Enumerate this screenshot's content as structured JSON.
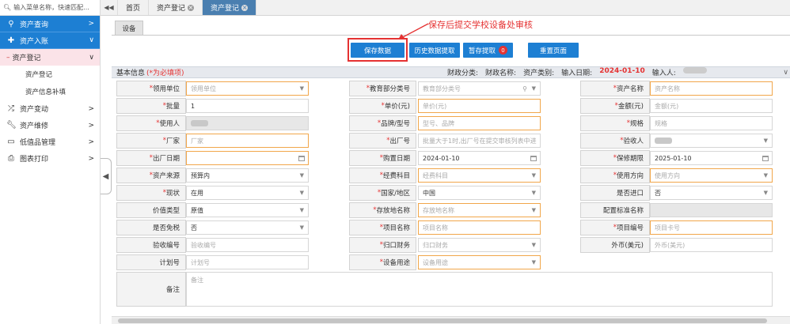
{
  "sidebar": {
    "search_placeholder": "输入菜单名称，快速匹配...",
    "items": [
      {
        "label": "资产查询",
        "icon": "search-icon",
        "chev": ">"
      },
      {
        "label": "资产入账",
        "icon": "plus-icon",
        "chev": "∨"
      },
      {
        "label": "资产登记",
        "chev": "∨"
      },
      {
        "label": "资产登记"
      },
      {
        "label": "资产信息补填"
      },
      {
        "label": "资产变动",
        "icon": "shuffle-icon",
        "chev": ">"
      },
      {
        "label": "资产维修",
        "icon": "wrench-icon",
        "chev": ">"
      },
      {
        "label": "低值品管理",
        "icon": "monitor-icon",
        "chev": ">"
      },
      {
        "label": "图表打印",
        "icon": "printer-icon",
        "chev": ">"
      }
    ]
  },
  "topbar": {
    "nav_left": "◀◀",
    "tabs": [
      {
        "label": "首页"
      },
      {
        "label": "资产登记",
        "close": "×"
      },
      {
        "label": "资产登记",
        "close": "×"
      }
    ]
  },
  "subtab": "设备",
  "annotation": "保存后提交学校设备处审核",
  "buttons": {
    "save": "保存数据",
    "history": "历史数据提取",
    "draft": "暂存提取",
    "draft_count": "0",
    "reset": "重置页面"
  },
  "info": {
    "title": "基本信息",
    "required_note": "(*为必填项)",
    "finance_class": "财政分类:",
    "finance_name": "财政名称:",
    "asset_type": "资产类别:",
    "input_date_label": "输入日期:",
    "input_date": "2024-01-10",
    "input_person_label": "输入人:"
  },
  "form": {
    "rows": [
      [
        {
          "label": "领用单位",
          "req": true,
          "placeholder": "领用单位",
          "style": "orange",
          "icon": "caret"
        },
        {
          "label": "教育部分类号",
          "req": true,
          "placeholder": "教育部分类号",
          "style": "plain",
          "icon": "search-caret"
        },
        {
          "label": "资产名称",
          "req": true,
          "placeholder": "资产名称",
          "style": "orange"
        }
      ],
      [
        {
          "label": "批量",
          "req": true,
          "value": "1",
          "style": "plain"
        },
        {
          "label": "单价(元)",
          "req": true,
          "placeholder": "单价(元)",
          "style": "orange"
        },
        {
          "label": "金额(元)",
          "req": true,
          "placeholder": "金额(元)",
          "style": "plain"
        }
      ],
      [
        {
          "label": "使用人",
          "req": true,
          "blur": true,
          "style": "gray"
        },
        {
          "label": "品牌/型号",
          "req": true,
          "placeholder": "型号、品牌",
          "style": "orange"
        },
        {
          "label": "规格",
          "req": true,
          "placeholder": "规格",
          "style": "plain"
        }
      ],
      [
        {
          "label": "厂家",
          "req": true,
          "placeholder": "厂家",
          "style": "orange"
        },
        {
          "label": "出厂号",
          "req": true,
          "placeholder": "批量大于1时,出厂号在提交审核列表中进",
          "style": "plain"
        },
        {
          "label": "验收人",
          "req": true,
          "blur": true,
          "style": "plain",
          "icon": "caret"
        }
      ],
      [
        {
          "label": "出厂日期",
          "req": true,
          "value": "",
          "style": "orange",
          "icon": "cal"
        },
        {
          "label": "购置日期",
          "req": true,
          "value": "2024-01-10",
          "style": "plain",
          "icon": "cal"
        },
        {
          "label": "保修期限",
          "req": true,
          "value": "2025-01-10",
          "style": "plain",
          "icon": "cal"
        }
      ],
      [
        {
          "label": "资产来源",
          "req": true,
          "value": "预算内",
          "style": "plain",
          "icon": "caret"
        },
        {
          "label": "经费科目",
          "req": true,
          "placeholder": "经费科目",
          "style": "orange",
          "icon": "caret"
        },
        {
          "label": "使用方向",
          "req": true,
          "placeholder": "使用方向",
          "style": "orange",
          "icon": "caret"
        }
      ],
      [
        {
          "label": "现状",
          "req": true,
          "value": "在用",
          "style": "plain",
          "icon": "caret"
        },
        {
          "label": "国家/地区",
          "req": true,
          "value": "中国",
          "style": "plain",
          "icon": "caret"
        },
        {
          "label": "是否进口",
          "req": false,
          "value": "否",
          "style": "plain",
          "icon": "caret"
        }
      ],
      [
        {
          "label": "价值类型",
          "req": false,
          "value": "原值",
          "style": "plain",
          "icon": "caret"
        },
        {
          "label": "存放地名称",
          "req": true,
          "placeholder": "存放地名称",
          "style": "orange",
          "icon": "caret"
        },
        {
          "label": "配置标准名称",
          "req": false,
          "value": "",
          "style": "gray"
        }
      ],
      [
        {
          "label": "是否免税",
          "req": false,
          "value": "否",
          "style": "plain",
          "icon": "caret"
        },
        {
          "label": "项目名称",
          "req": true,
          "placeholder": "项目名称",
          "style": "orange"
        },
        {
          "label": "项目编号",
          "req": true,
          "placeholder": "项目卡号",
          "style": "orange"
        }
      ],
      [
        {
          "label": "验收编号",
          "req": false,
          "placeholder": "验收编号",
          "style": "plain"
        },
        {
          "label": "归口财务",
          "req": true,
          "placeholder": "归口财务",
          "style": "plain",
          "icon": "caret"
        },
        {
          "label": "外币(美元)",
          "req": false,
          "placeholder": "外币(美元)",
          "style": "plain"
        }
      ],
      [
        {
          "label": "计划号",
          "req": false,
          "placeholder": "计划号",
          "style": "plain"
        },
        {
          "label": "设备用途",
          "req": true,
          "placeholder": "设备用途",
          "style": "orange",
          "icon": "caret"
        }
      ]
    ],
    "remark_label": "备注",
    "remark_placeholder": "备注"
  }
}
